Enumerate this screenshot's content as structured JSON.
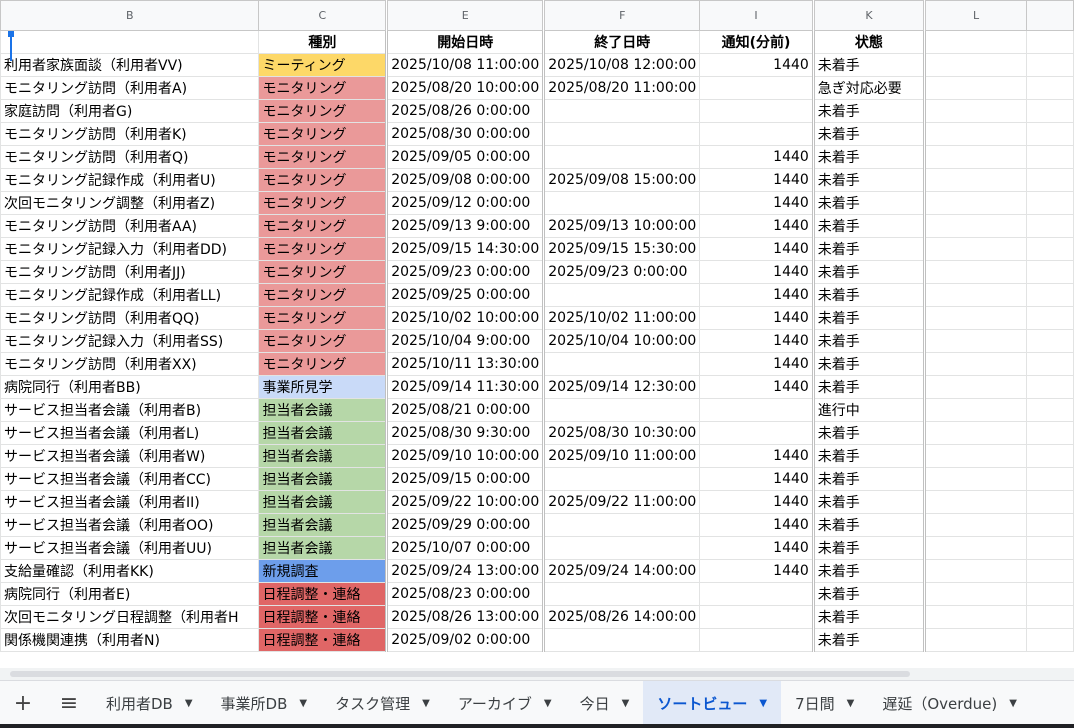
{
  "colors": {
    "meeting": "#fdd868",
    "monitoring": "#ea9999",
    "office_visit": "#c9daf8",
    "staff_meeting": "#b6d7a8",
    "new_survey": "#6d9eeb",
    "schedule": "#e06666"
  },
  "columns": [
    "B",
    "C",
    "E",
    "F",
    "I",
    "K",
    "L"
  ],
  "headers": [
    "",
    "種別",
    "開始日時",
    "終了日時",
    "通知(分前)",
    "状態",
    ""
  ],
  "rows": [
    {
      "name": "利用者家族面談（利用者VV)",
      "type": "ミーティング",
      "start": "2025/10/08 11:00:00",
      "end": "2025/10/08 12:00:00",
      "notify": "1440",
      "status": "未着手",
      "c": "meeting"
    },
    {
      "name": "モニタリング訪問（利用者A)",
      "type": "モニタリング",
      "start": "2025/08/20 10:00:00",
      "end": "2025/08/20 11:00:00",
      "notify": "",
      "status": "急ぎ対応必要",
      "c": "monitoring"
    },
    {
      "name": "家庭訪問（利用者G)",
      "type": "モニタリング",
      "start": "2025/08/26 0:00:00",
      "end": "",
      "notify": "",
      "status": "未着手",
      "c": "monitoring"
    },
    {
      "name": "モニタリング訪問（利用者K)",
      "type": "モニタリング",
      "start": "2025/08/30 0:00:00",
      "end": "",
      "notify": "",
      "status": "未着手",
      "c": "monitoring"
    },
    {
      "name": "モニタリング訪問（利用者Q)",
      "type": "モニタリング",
      "start": "2025/09/05 0:00:00",
      "end": "",
      "notify": "1440",
      "status": "未着手",
      "c": "monitoring"
    },
    {
      "name": "モニタリング記録作成（利用者U)",
      "type": "モニタリング",
      "start": "2025/09/08 0:00:00",
      "end": "2025/09/08 15:00:00",
      "notify": "1440",
      "status": "未着手",
      "c": "monitoring"
    },
    {
      "name": "次回モニタリング調整（利用者Z)",
      "type": "モニタリング",
      "start": "2025/09/12 0:00:00",
      "end": "",
      "notify": "1440",
      "status": "未着手",
      "c": "monitoring"
    },
    {
      "name": "モニタリング訪問（利用者AA)",
      "type": "モニタリング",
      "start": "2025/09/13 9:00:00",
      "end": "2025/09/13 10:00:00",
      "notify": "1440",
      "status": "未着手",
      "c": "monitoring"
    },
    {
      "name": "モニタリング記録入力（利用者DD)",
      "type": "モニタリング",
      "start": "2025/09/15 14:30:00",
      "end": "2025/09/15 15:30:00",
      "notify": "1440",
      "status": "未着手",
      "c": "monitoring"
    },
    {
      "name": "モニタリング訪問（利用者JJ)",
      "type": "モニタリング",
      "start": "2025/09/23 0:00:00",
      "end": "2025/09/23 0:00:00",
      "notify": "1440",
      "status": "未着手",
      "c": "monitoring"
    },
    {
      "name": "モニタリング記録作成（利用者LL)",
      "type": "モニタリング",
      "start": "2025/09/25 0:00:00",
      "end": "",
      "notify": "1440",
      "status": "未着手",
      "c": "monitoring"
    },
    {
      "name": "モニタリング訪問（利用者QQ)",
      "type": "モニタリング",
      "start": "2025/10/02 10:00:00",
      "end": "2025/10/02 11:00:00",
      "notify": "1440",
      "status": "未着手",
      "c": "monitoring"
    },
    {
      "name": "モニタリング記録入力（利用者SS)",
      "type": "モニタリング",
      "start": "2025/10/04 9:00:00",
      "end": "2025/10/04 10:00:00",
      "notify": "1440",
      "status": "未着手",
      "c": "monitoring"
    },
    {
      "name": "モニタリング訪問（利用者XX)",
      "type": "モニタリング",
      "start": "2025/10/11 13:30:00",
      "end": "",
      "notify": "1440",
      "status": "未着手",
      "c": "monitoring"
    },
    {
      "name": "病院同行（利用者BB)",
      "type": "事業所見学",
      "start": "2025/09/14 11:30:00",
      "end": "2025/09/14 12:30:00",
      "notify": "1440",
      "status": "未着手",
      "c": "office_visit"
    },
    {
      "name": "サービス担当者会議（利用者B)",
      "type": "担当者会議",
      "start": "2025/08/21 0:00:00",
      "end": "",
      "notify": "",
      "status": "進行中",
      "c": "staff_meeting"
    },
    {
      "name": "サービス担当者会議（利用者L)",
      "type": "担当者会議",
      "start": "2025/08/30 9:30:00",
      "end": "2025/08/30 10:30:00",
      "notify": "",
      "status": "未着手",
      "c": "staff_meeting"
    },
    {
      "name": "サービス担当者会議（利用者W)",
      "type": "担当者会議",
      "start": "2025/09/10 10:00:00",
      "end": "2025/09/10 11:00:00",
      "notify": "1440",
      "status": "未着手",
      "c": "staff_meeting"
    },
    {
      "name": "サービス担当者会議（利用者CC)",
      "type": "担当者会議",
      "start": "2025/09/15 0:00:00",
      "end": "",
      "notify": "1440",
      "status": "未着手",
      "c": "staff_meeting"
    },
    {
      "name": "サービス担当者会議（利用者II)",
      "type": "担当者会議",
      "start": "2025/09/22 10:00:00",
      "end": "2025/09/22 11:00:00",
      "notify": "1440",
      "status": "未着手",
      "c": "staff_meeting"
    },
    {
      "name": "サービス担当者会議（利用者OO)",
      "type": "担当者会議",
      "start": "2025/09/29 0:00:00",
      "end": "",
      "notify": "1440",
      "status": "未着手",
      "c": "staff_meeting"
    },
    {
      "name": "サービス担当者会議（利用者UU)",
      "type": "担当者会議",
      "start": "2025/10/07 0:00:00",
      "end": "",
      "notify": "1440",
      "status": "未着手",
      "c": "staff_meeting"
    },
    {
      "name": "支給量確認（利用者KK)",
      "type": "新規調査",
      "start": "2025/09/24 13:00:00",
      "end": "2025/09/24 14:00:00",
      "notify": "1440",
      "status": "未着手",
      "c": "new_survey"
    },
    {
      "name": "病院同行（利用者E)",
      "type": "日程調整・連絡",
      "start": "2025/08/23 0:00:00",
      "end": "",
      "notify": "",
      "status": "未着手",
      "c": "schedule"
    },
    {
      "name": "次回モニタリング日程調整（利用者H",
      "type": "日程調整・連絡",
      "start": "2025/08/26 13:00:00",
      "end": "2025/08/26 14:00:00",
      "notify": "",
      "status": "未着手",
      "c": "schedule"
    },
    {
      "name": "関係機関連携（利用者N)",
      "type": "日程調整・連絡",
      "start": "2025/09/02 0:00:00",
      "end": "",
      "notify": "",
      "status": "未着手",
      "c": "schedule"
    }
  ],
  "tabs": [
    {
      "label": "利用者DB",
      "active": false
    },
    {
      "label": "事業所DB",
      "active": false
    },
    {
      "label": "タスク管理",
      "active": false
    },
    {
      "label": "アーカイブ",
      "active": false
    },
    {
      "label": "今日",
      "active": false
    },
    {
      "label": "ソートビュー",
      "active": true
    },
    {
      "label": "7日間",
      "active": false
    },
    {
      "label": "遅延（Overdue)",
      "active": false
    }
  ],
  "tabbar": {
    "add": "+",
    "menu": "≡",
    "caret": "▼"
  }
}
